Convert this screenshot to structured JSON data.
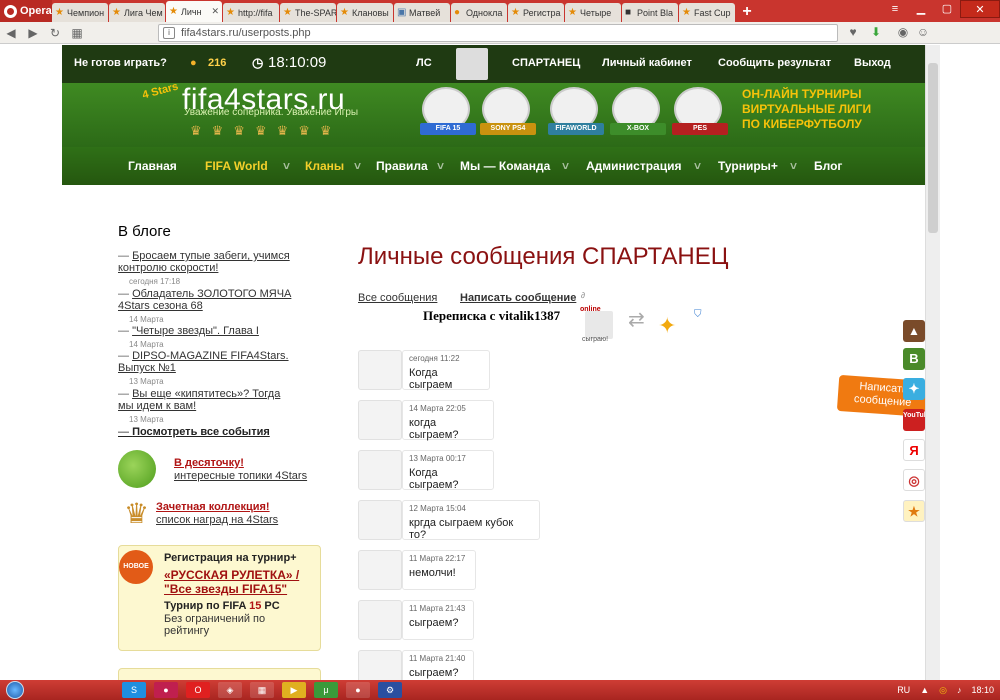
{
  "browser": {
    "opera_label": "Opera",
    "tabs": [
      {
        "label": "Чемпион"
      },
      {
        "label": "Лига Чем"
      },
      {
        "label": "Личн",
        "active": true
      },
      {
        "label": "http://fifa"
      },
      {
        "label": "The-SPAR"
      },
      {
        "label": "Клановы"
      },
      {
        "label": "Матвей"
      },
      {
        "label": "Однокла"
      },
      {
        "label": "Регистра"
      },
      {
        "label": "Четыре"
      },
      {
        "label": "Point Bla"
      },
      {
        "label": "Fast Cup"
      }
    ],
    "url": "fifa4stars.ru/userposts.php"
  },
  "site": {
    "not_ready": "Не готов играть?",
    "coins": "216",
    "clock": "18:10:09",
    "ls": "ЛС",
    "username": "СПАРТАНЕЦ",
    "cabinet": "Личный кабинет",
    "report": "Сообщить результат",
    "logout": "Выход",
    "logo": "fifa4stars.ru",
    "logo_badge": "4 Stars",
    "slogan": "Уважение соперника. Уважение Игры",
    "platforms": [
      "FIFA 15",
      "SONY PS4",
      "FIFAWORLD",
      "X-BOX",
      "PES"
    ],
    "tagline": [
      "ОН-ЛАЙН ТУРНИРЫ",
      "ВИРТУАЛЬНЫЕ ЛИГИ",
      "ПО КИБЕРФУТБОЛУ"
    ],
    "nav": [
      "Главная",
      "FIFA World",
      "Кланы",
      "Правила",
      "Мы — Команда",
      "Администрация",
      "Турниры+",
      "Блог"
    ]
  },
  "sidebar": {
    "blog_title": "В блоге",
    "posts": [
      {
        "title": "Бросаем тупые забеги, учимся контролю скорости!",
        "date": "сегодня 17:18"
      },
      {
        "title": "Обладатель ЗОЛОТОГО МЯЧА 4Stars сезона 68",
        "date": "14 Марта"
      },
      {
        "title": "\"Четыре звезды\". Глава I",
        "date": "14 Марта"
      },
      {
        "title": "DIPSO-MAGAZINE FIFA4Stars. Выпуск №1",
        "date": "13 Марта"
      },
      {
        "title": "Вы еще «кипятитесь»? Тогда мы идем к вам!",
        "date": "13 Марта"
      }
    ],
    "all_events": "Посмотреть все события",
    "top10_title": "В десяточку!",
    "top10_sub": "интересные топики 4Stars",
    "collection_title": "Зачетная коллекция!",
    "collection_sub": "список наград на 4Stars",
    "tournament": {
      "badge": "НОВОЕ",
      "reg": "Регистрация на турнир+",
      "name": "«РУССКАЯ РУЛЕТКА» / \"Все звезды FIFA15\"",
      "line_pre": "Турнир по FIFA ",
      "line_num": "15",
      "line_post": " PC",
      "note": "Без ограничений по рейтингу"
    }
  },
  "main": {
    "title": "Личные сообщения СПАРТАНЕЦ",
    "tab_all": "Все сообщения",
    "tab_write": "Написать сообщение",
    "correspondence": "Переписка с vitalik1387",
    "online": "online",
    "status": "сыграю!",
    "messages": [
      {
        "time": "сегодня 11:22",
        "text": "Когда сыграем"
      },
      {
        "time": "14 Марта 22:05",
        "text": "когда сыграем?"
      },
      {
        "time": "13 Марта 00:17",
        "text": "Когда сыграем?"
      },
      {
        "time": "12 Марта 15:04",
        "text": "кргда сыграем кубок то?"
      },
      {
        "time": "11 Марта 22:17",
        "text": "немолчи!"
      },
      {
        "time": "11 Марта 21:43",
        "text": "сыграем?"
      },
      {
        "time": "11 Марта 21:40",
        "text": "сыграем?"
      }
    ]
  },
  "float": {
    "write_label": "Написать сообщение"
  },
  "social": [
    "В",
    "Я",
    "YouTube"
  ],
  "taskbar": {
    "lang": "RU",
    "time": "18:10"
  },
  "colors": {
    "accent_red": "#8a1111",
    "header_green": "#2e6a1e",
    "nav_yellow": "#f4d02b",
    "tab_red": "#c9352e"
  }
}
